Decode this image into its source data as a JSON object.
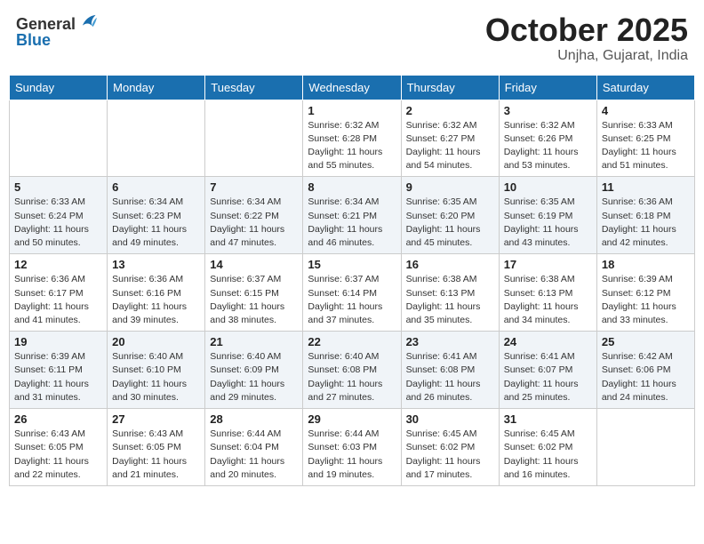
{
  "header": {
    "logo_general": "General",
    "logo_blue": "Blue",
    "month": "October 2025",
    "location": "Unjha, Gujarat, India"
  },
  "days_of_week": [
    "Sunday",
    "Monday",
    "Tuesday",
    "Wednesday",
    "Thursday",
    "Friday",
    "Saturday"
  ],
  "weeks": [
    [
      {
        "day": "",
        "info": ""
      },
      {
        "day": "",
        "info": ""
      },
      {
        "day": "",
        "info": ""
      },
      {
        "day": "1",
        "info": "Sunrise: 6:32 AM\nSunset: 6:28 PM\nDaylight: 11 hours\nand 55 minutes."
      },
      {
        "day": "2",
        "info": "Sunrise: 6:32 AM\nSunset: 6:27 PM\nDaylight: 11 hours\nand 54 minutes."
      },
      {
        "day": "3",
        "info": "Sunrise: 6:32 AM\nSunset: 6:26 PM\nDaylight: 11 hours\nand 53 minutes."
      },
      {
        "day": "4",
        "info": "Sunrise: 6:33 AM\nSunset: 6:25 PM\nDaylight: 11 hours\nand 51 minutes."
      }
    ],
    [
      {
        "day": "5",
        "info": "Sunrise: 6:33 AM\nSunset: 6:24 PM\nDaylight: 11 hours\nand 50 minutes."
      },
      {
        "day": "6",
        "info": "Sunrise: 6:34 AM\nSunset: 6:23 PM\nDaylight: 11 hours\nand 49 minutes."
      },
      {
        "day": "7",
        "info": "Sunrise: 6:34 AM\nSunset: 6:22 PM\nDaylight: 11 hours\nand 47 minutes."
      },
      {
        "day": "8",
        "info": "Sunrise: 6:34 AM\nSunset: 6:21 PM\nDaylight: 11 hours\nand 46 minutes."
      },
      {
        "day": "9",
        "info": "Sunrise: 6:35 AM\nSunset: 6:20 PM\nDaylight: 11 hours\nand 45 minutes."
      },
      {
        "day": "10",
        "info": "Sunrise: 6:35 AM\nSunset: 6:19 PM\nDaylight: 11 hours\nand 43 minutes."
      },
      {
        "day": "11",
        "info": "Sunrise: 6:36 AM\nSunset: 6:18 PM\nDaylight: 11 hours\nand 42 minutes."
      }
    ],
    [
      {
        "day": "12",
        "info": "Sunrise: 6:36 AM\nSunset: 6:17 PM\nDaylight: 11 hours\nand 41 minutes."
      },
      {
        "day": "13",
        "info": "Sunrise: 6:36 AM\nSunset: 6:16 PM\nDaylight: 11 hours\nand 39 minutes."
      },
      {
        "day": "14",
        "info": "Sunrise: 6:37 AM\nSunset: 6:15 PM\nDaylight: 11 hours\nand 38 minutes."
      },
      {
        "day": "15",
        "info": "Sunrise: 6:37 AM\nSunset: 6:14 PM\nDaylight: 11 hours\nand 37 minutes."
      },
      {
        "day": "16",
        "info": "Sunrise: 6:38 AM\nSunset: 6:13 PM\nDaylight: 11 hours\nand 35 minutes."
      },
      {
        "day": "17",
        "info": "Sunrise: 6:38 AM\nSunset: 6:13 PM\nDaylight: 11 hours\nand 34 minutes."
      },
      {
        "day": "18",
        "info": "Sunrise: 6:39 AM\nSunset: 6:12 PM\nDaylight: 11 hours\nand 33 minutes."
      }
    ],
    [
      {
        "day": "19",
        "info": "Sunrise: 6:39 AM\nSunset: 6:11 PM\nDaylight: 11 hours\nand 31 minutes."
      },
      {
        "day": "20",
        "info": "Sunrise: 6:40 AM\nSunset: 6:10 PM\nDaylight: 11 hours\nand 30 minutes."
      },
      {
        "day": "21",
        "info": "Sunrise: 6:40 AM\nSunset: 6:09 PM\nDaylight: 11 hours\nand 29 minutes."
      },
      {
        "day": "22",
        "info": "Sunrise: 6:40 AM\nSunset: 6:08 PM\nDaylight: 11 hours\nand 27 minutes."
      },
      {
        "day": "23",
        "info": "Sunrise: 6:41 AM\nSunset: 6:08 PM\nDaylight: 11 hours\nand 26 minutes."
      },
      {
        "day": "24",
        "info": "Sunrise: 6:41 AM\nSunset: 6:07 PM\nDaylight: 11 hours\nand 25 minutes."
      },
      {
        "day": "25",
        "info": "Sunrise: 6:42 AM\nSunset: 6:06 PM\nDaylight: 11 hours\nand 24 minutes."
      }
    ],
    [
      {
        "day": "26",
        "info": "Sunrise: 6:43 AM\nSunset: 6:05 PM\nDaylight: 11 hours\nand 22 minutes."
      },
      {
        "day": "27",
        "info": "Sunrise: 6:43 AM\nSunset: 6:05 PM\nDaylight: 11 hours\nand 21 minutes."
      },
      {
        "day": "28",
        "info": "Sunrise: 6:44 AM\nSunset: 6:04 PM\nDaylight: 11 hours\nand 20 minutes."
      },
      {
        "day": "29",
        "info": "Sunrise: 6:44 AM\nSunset: 6:03 PM\nDaylight: 11 hours\nand 19 minutes."
      },
      {
        "day": "30",
        "info": "Sunrise: 6:45 AM\nSunset: 6:02 PM\nDaylight: 11 hours\nand 17 minutes."
      },
      {
        "day": "31",
        "info": "Sunrise: 6:45 AM\nSunset: 6:02 PM\nDaylight: 11 hours\nand 16 minutes."
      },
      {
        "day": "",
        "info": ""
      }
    ]
  ]
}
